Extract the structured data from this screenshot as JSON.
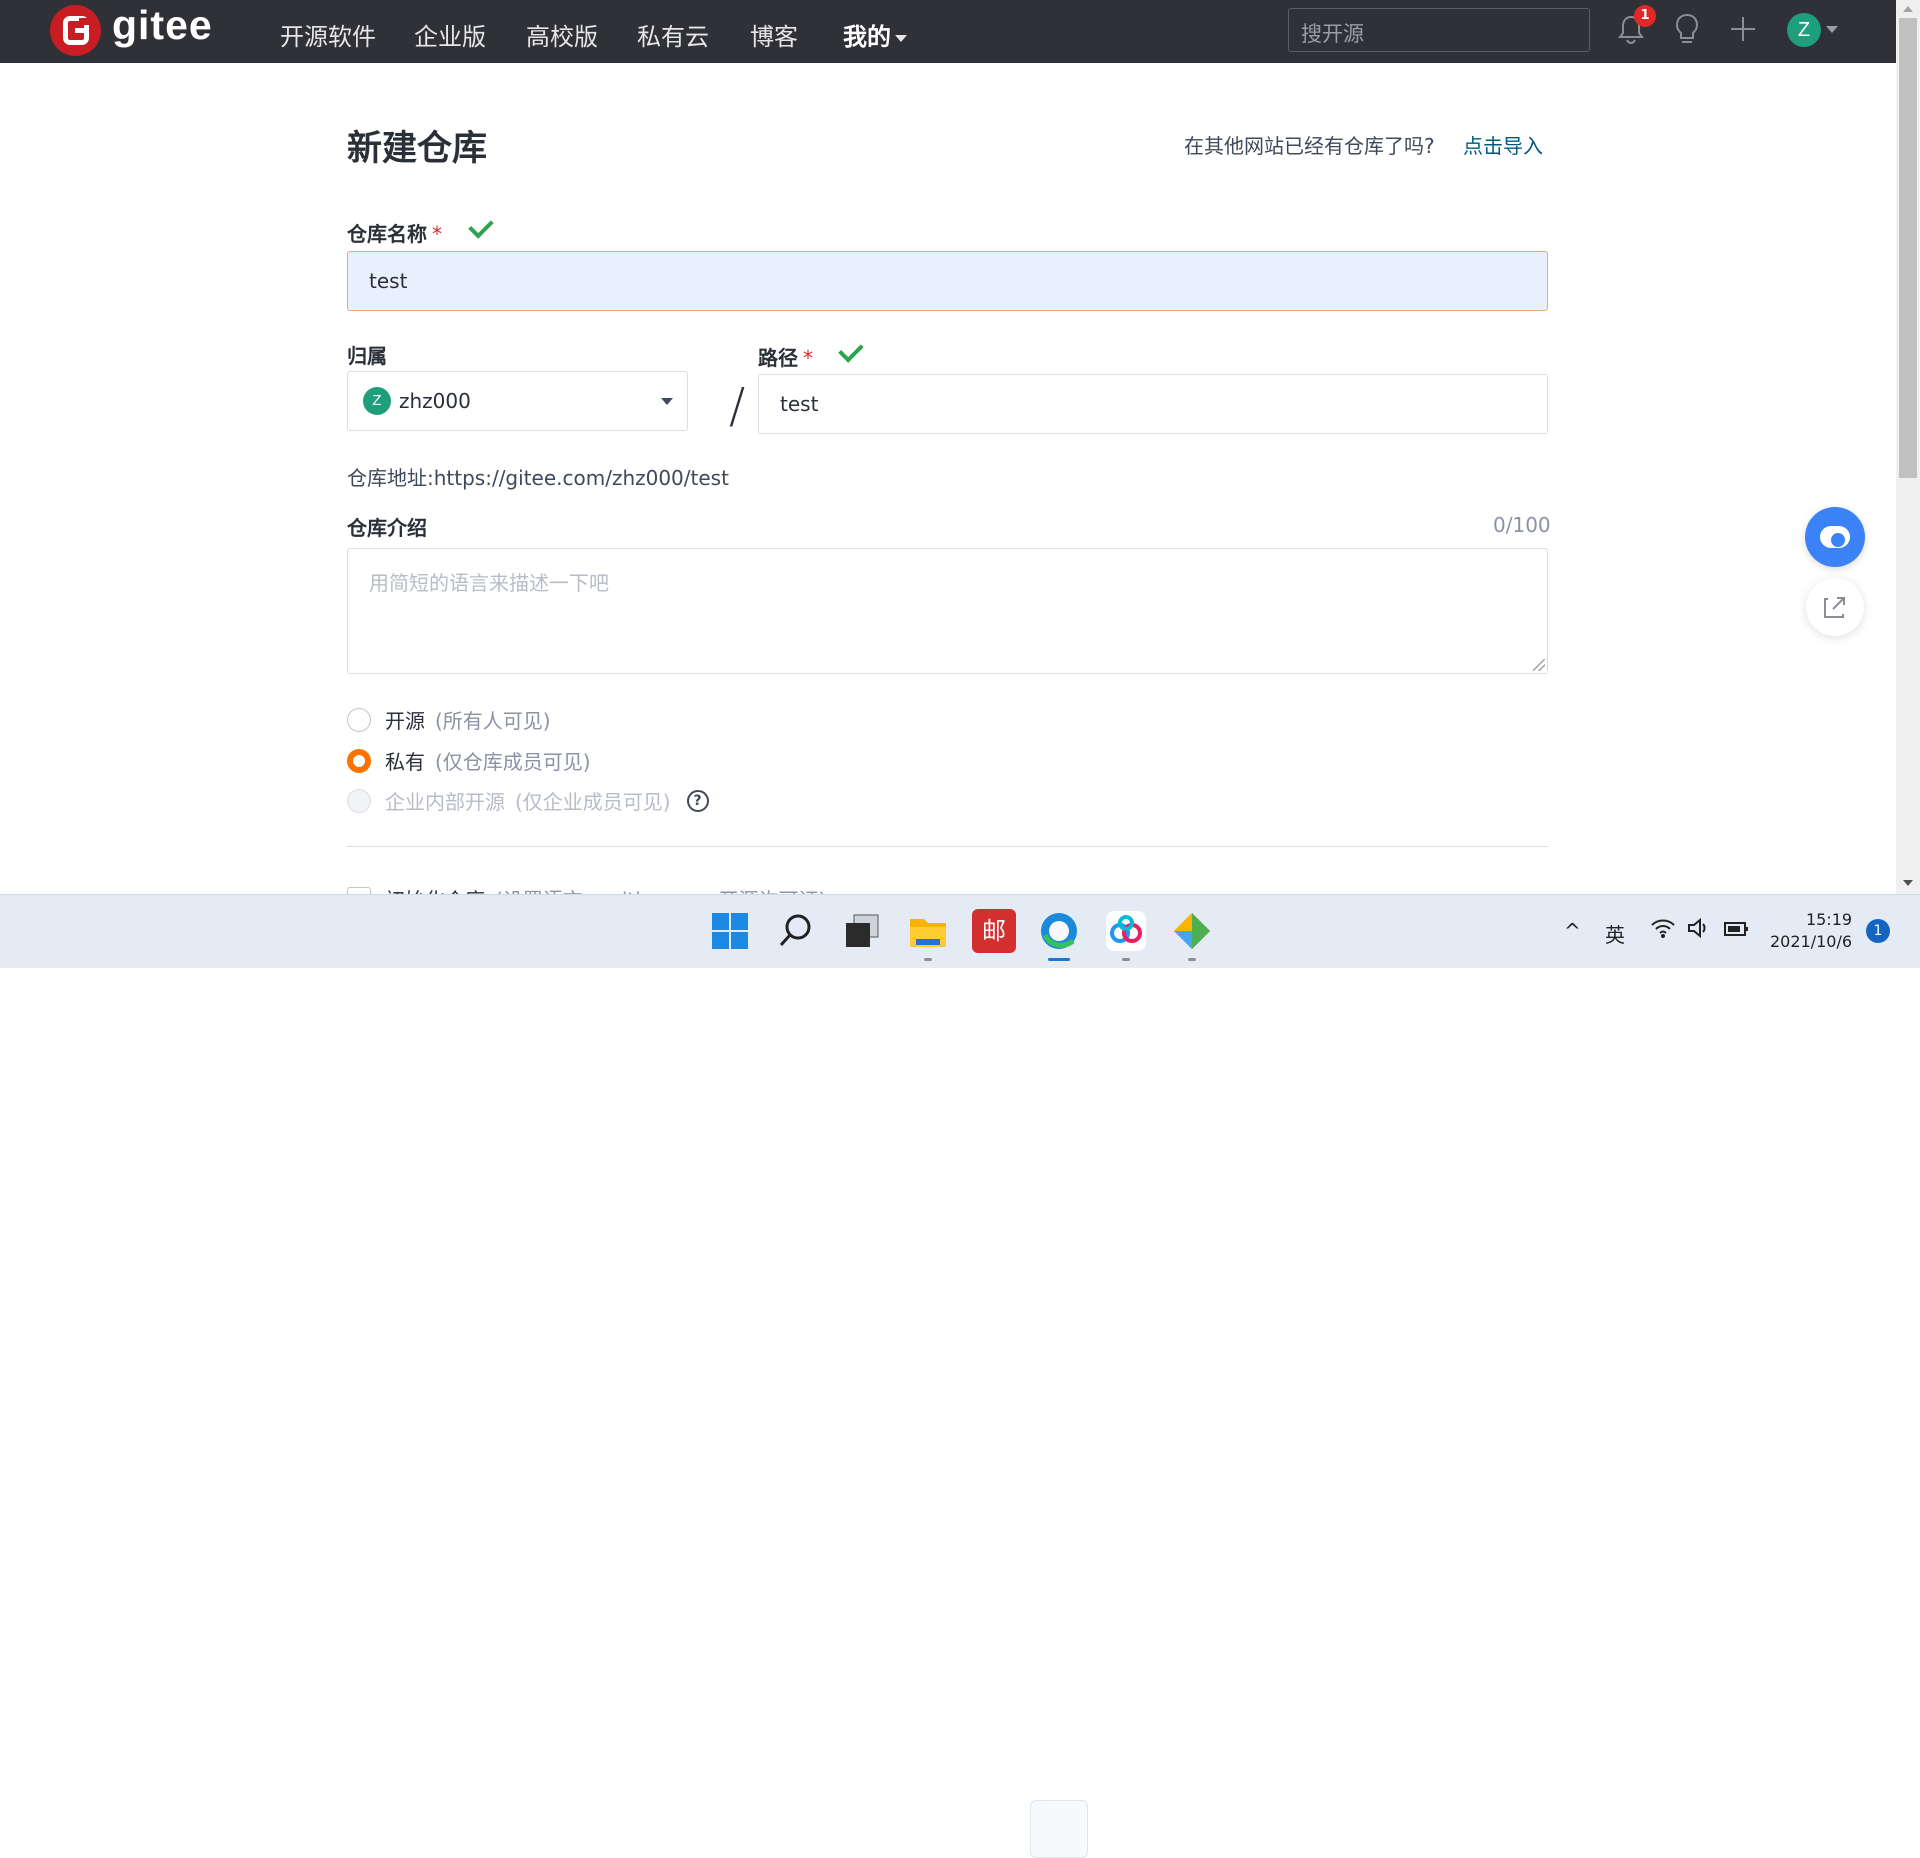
{
  "header": {
    "logo_text": "gitee",
    "nav": [
      "开源软件",
      "企业版",
      "高校版",
      "私有云",
      "博客"
    ],
    "my_label": "我的",
    "search_placeholder": "搜开源",
    "notification_count": "1",
    "avatar_letter": "Z"
  },
  "page": {
    "title": "新建仓库",
    "import_prompt": "在其他网站已经有仓库了吗?",
    "import_link": "点击导入"
  },
  "form": {
    "name_label": "仓库名称",
    "required_mark": "*",
    "name_value": "test",
    "owner_label": "归属",
    "owner_avatar": "Z",
    "owner_value": "zhz000",
    "separator": "/",
    "path_label": "路径",
    "path_value": "test",
    "address_text": "仓库地址:https://gitee.com/zhz000/test",
    "intro_label": "仓库介绍",
    "intro_counter": "0/100",
    "intro_placeholder": "用简短的语言来描述一下吧",
    "visibility": [
      {
        "label": "开源",
        "note": "(所有人可见)",
        "selected": false,
        "disabled": false
      },
      {
        "label": "私有",
        "note": "(仅仓库成员可见)",
        "selected": true,
        "disabled": false
      },
      {
        "label": "企业内部开源",
        "note": "(仅企业成员可见)",
        "selected": false,
        "disabled": true
      }
    ],
    "help_mark": "?",
    "init_label": "初始化仓库",
    "init_note": "(设置语言、.gitignore、开源许可证)"
  },
  "colors": {
    "nav_bg": "#2f3136",
    "brand_red": "#c71d23",
    "accent_orange": "#fe7300",
    "link_blue": "#005980",
    "check_green": "#2ea44f"
  },
  "taskbar": {
    "icons": [
      "windows-start-icon",
      "search-icon",
      "task-view-icon",
      "file-explorer-icon",
      "app-red-icon",
      "edge-icon",
      "baidu-netdisk-icon",
      "git-icon"
    ],
    "ime": "英",
    "caret_up": "^",
    "time": "15:19",
    "date": "2021/10/6",
    "notifications": "1"
  }
}
